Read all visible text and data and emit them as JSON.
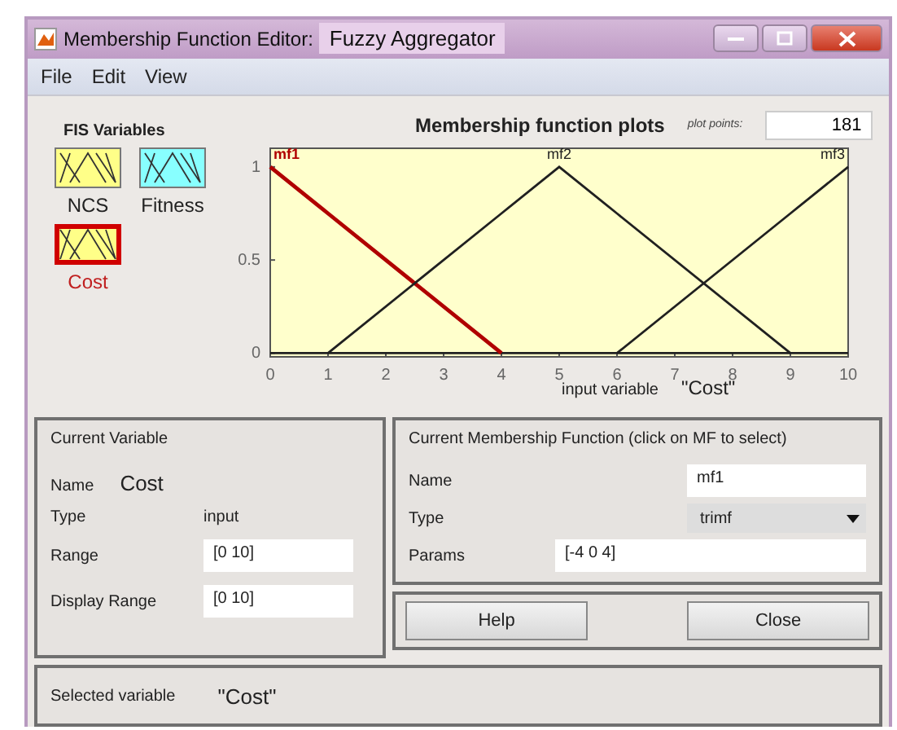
{
  "window": {
    "title": "Membership Function Editor:",
    "fis_name": "Fuzzy Aggregator"
  },
  "menu": [
    "File",
    "Edit",
    "View"
  ],
  "fis_variables": {
    "title": "FIS Variables",
    "items": [
      {
        "label": "NCS",
        "kind": "input",
        "selected": false
      },
      {
        "label": "Fitness",
        "kind": "output",
        "selected": false
      },
      {
        "label": "Cost",
        "kind": "input",
        "selected": true
      }
    ]
  },
  "plot": {
    "title": "Membership function plots",
    "points_label": "plot points:",
    "points": "181",
    "xlabel": "input variable",
    "variable": "\"Cost\"",
    "chart_data": {
      "type": "line",
      "x": [
        0,
        1,
        4,
        5,
        6,
        9,
        10
      ],
      "series": [
        {
          "name": "mf1",
          "color": "#b00000",
          "values": [
            1,
            0.75,
            0,
            null,
            null,
            null,
            null
          ]
        },
        {
          "name": "mf2",
          "color": "#202020",
          "values": [
            null,
            0,
            0.75,
            1,
            0.75,
            0,
            null
          ]
        },
        {
          "name": "mf3",
          "color": "#202020",
          "values": [
            null,
            null,
            null,
            null,
            0,
            0.75,
            1
          ]
        }
      ],
      "xlim": [
        0,
        10
      ],
      "ylim": [
        -0.02,
        1.1
      ],
      "xticks": [
        0,
        1,
        2,
        3,
        4,
        5,
        6,
        7,
        8,
        9,
        10
      ],
      "yticks": [
        0,
        0.5,
        1
      ]
    }
  },
  "current_variable": {
    "title": "Current Variable",
    "name_label": "Name",
    "name": "Cost",
    "type_label": "Type",
    "type": "input",
    "range_label": "Range",
    "range": "[0 10]",
    "display_range_label": "Display Range",
    "display_range": "[0 10]"
  },
  "current_mf": {
    "title": "Current Membership Function (click on MF to select)",
    "name_label": "Name",
    "name": "mf1",
    "type_label": "Type",
    "type": "trimf",
    "params_label": "Params",
    "params": "[-4 0 4]"
  },
  "buttons": [
    "Help",
    "Close"
  ],
  "status": {
    "label": "Selected variable",
    "value": "\"Cost\""
  }
}
